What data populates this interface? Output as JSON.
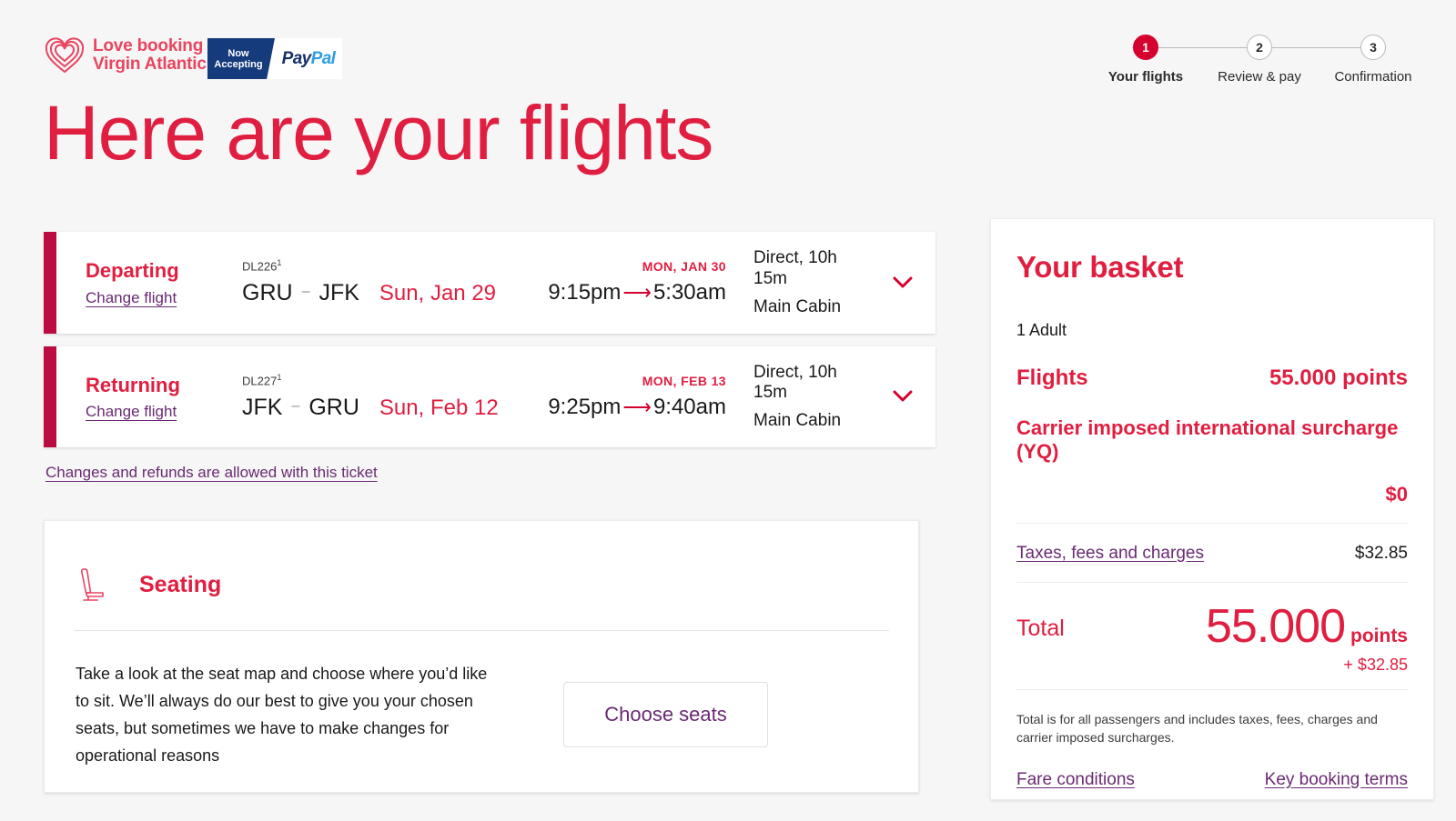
{
  "brand": {
    "line1": "Love booking",
    "line2": "Virgin Atlantic",
    "logo_icon": "heart-logo-icon",
    "paypal": {
      "now": "Now",
      "accepting": "Accepting",
      "pay": "Pay",
      "pal": "Pal"
    }
  },
  "stepper": {
    "steps": [
      {
        "number": "1",
        "label": "Your flights",
        "active": true
      },
      {
        "number": "2",
        "label": "Review & pay",
        "active": false
      },
      {
        "number": "3",
        "label": "Confirmation",
        "active": false
      }
    ]
  },
  "page": {
    "title": "Here are your flights",
    "accent_color": "#e01e40",
    "bar_color": "#ba0c41",
    "link_color": "#6a2a73",
    "background": "#f7f6f7"
  },
  "flights": [
    {
      "direction": "Departing",
      "change_label": "Change flight",
      "flight_number": "DL226",
      "flight_footnote": "1",
      "origin": "GRU",
      "destination": "JFK",
      "depart_date": "Sun, Jan 29",
      "arrive_day": "MON, JAN 30",
      "depart_time": "9:15pm",
      "arrive_time": "5:30am",
      "duration": "Direct, 10h 15m",
      "cabin": "Main Cabin",
      "expand_icon": "chevron-down-icon"
    },
    {
      "direction": "Returning",
      "change_label": "Change flight",
      "flight_number": "DL227",
      "flight_footnote": "1",
      "origin": "JFK",
      "destination": "GRU",
      "depart_date": "Sun, Feb 12",
      "arrive_day": "MON, FEB 13",
      "depart_time": "9:25pm",
      "arrive_time": "9:40am",
      "duration": "Direct, 10h 15m",
      "cabin": "Main Cabin",
      "expand_icon": "chevron-down-icon"
    }
  ],
  "changes_note": "Changes and refunds are allowed with this ticket",
  "seating": {
    "icon": "airplane-seat-icon",
    "title": "Seating",
    "copy": "Take a look at the seat map and choose where you’d like to sit. We’ll always do our best to give you your chosen seats, but sometimes we have to make changes for operational reasons",
    "button_label": "Choose seats"
  },
  "basket": {
    "title": "Your basket",
    "passengers": "1 Adult",
    "flights_label": "Flights",
    "flights_value": "55.000 points",
    "surcharge_label": "Carrier imposed international surcharge (YQ)",
    "surcharge_value": "$0",
    "taxes_label": "Taxes, fees and charges",
    "taxes_value": "$32.85",
    "total_label": "Total",
    "total_points": "55.000",
    "total_points_unit": "points",
    "total_extra": "+ $32.85",
    "fineprint": "Total is for all passengers and includes taxes, fees, charges and carrier imposed surcharges.",
    "fare_conditions_label": "Fare conditions",
    "key_terms_label": "Key booking terms"
  }
}
